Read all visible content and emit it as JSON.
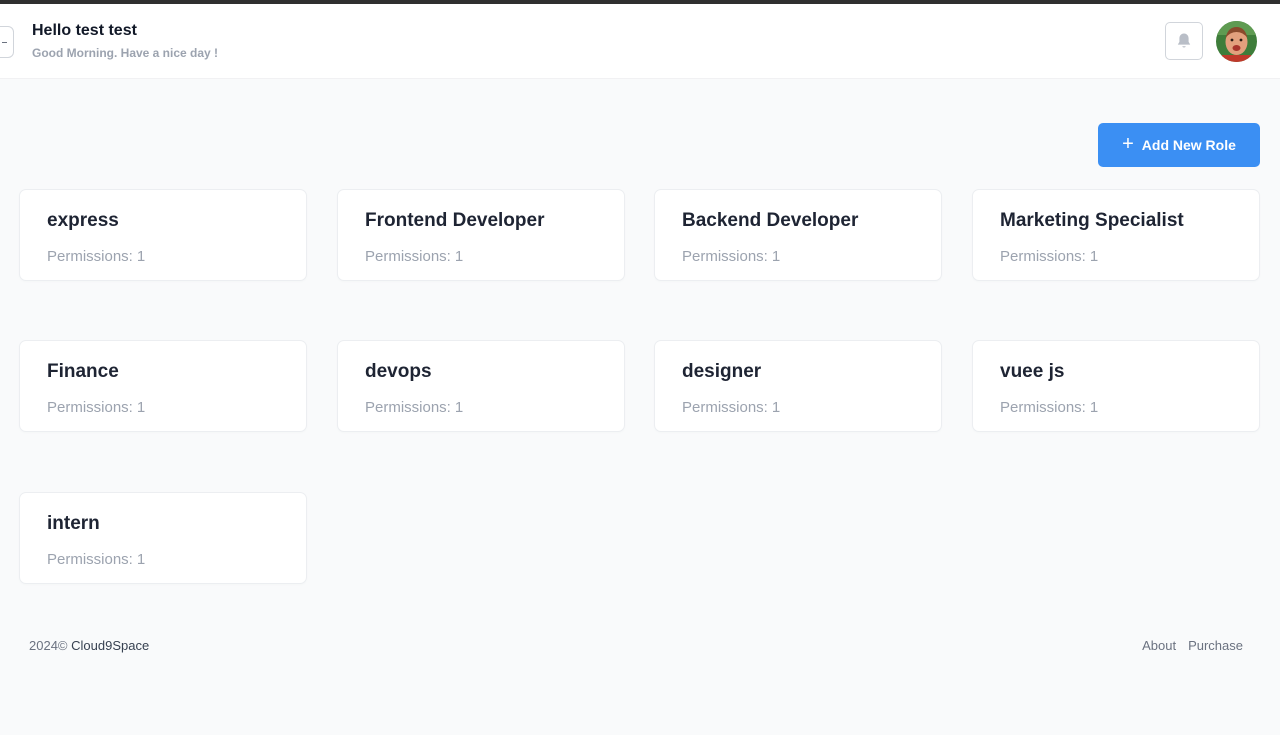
{
  "header": {
    "greeting": "Hello test test",
    "subtitle": "Good Morning. Have a nice day !",
    "bell_icon": "bell-icon",
    "avatar_icon": "user-avatar"
  },
  "actions": {
    "add_role_label": "Add New Role",
    "add_role_icon": "plus-icon",
    "accent": "#3b8ff3"
  },
  "roles": [
    {
      "name": "express",
      "permissions_label": "Permissions:",
      "permissions": "1"
    },
    {
      "name": "Frontend Developer",
      "permissions_label": "Permissions:",
      "permissions": "1"
    },
    {
      "name": "Backend Developer",
      "permissions_label": "Permissions:",
      "permissions": "1"
    },
    {
      "name": "Marketing Specialist",
      "permissions_label": "Permissions:",
      "permissions": "1"
    },
    {
      "name": "Finance",
      "permissions_label": "Permissions:",
      "permissions": "1"
    },
    {
      "name": "devops",
      "permissions_label": "Permissions:",
      "permissions": "1"
    },
    {
      "name": "designer",
      "permissions_label": "Permissions:",
      "permissions": "1"
    },
    {
      "name": "vuee js",
      "permissions_label": "Permissions:",
      "permissions": "1"
    },
    {
      "name": "intern",
      "permissions_label": "Permissions:",
      "permissions": "1"
    }
  ],
  "footer": {
    "copyright": "2024©",
    "brand": "Cloud9Space",
    "links": [
      "About",
      "Purchase"
    ]
  }
}
